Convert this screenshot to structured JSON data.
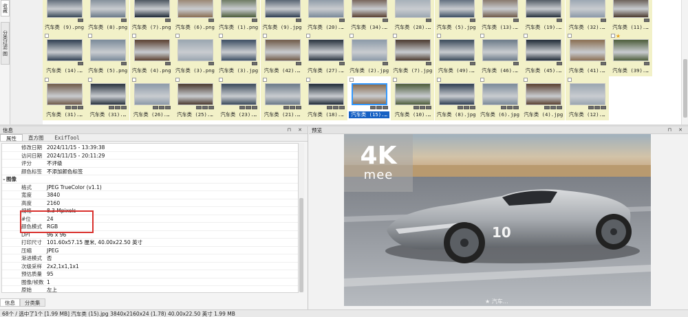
{
  "side_tabs": [
    "收藏",
    "分类过滤 图"
  ],
  "thumbnails": {
    "rows": [
      [
        "汽车类 (9).png",
        "汽车类 (8).png",
        "汽车类 (7).png",
        "汽车类 (6).png",
        "汽车类 (1).png",
        "汽车类 (9).jpg",
        "汽车类 (20).…",
        "汽车类 (34).…",
        "汽车类 (28).…",
        "汽车类 (5).jpg",
        "汽车类 (13).…",
        "汽车类 (19).…",
        "汽车类 (32).…",
        "汽车类 (11).…"
      ],
      [
        "汽车类 (14).…",
        "汽车类 (5).png",
        "汽车类 (4).png",
        "汽车类 (3).png",
        "汽车类 (3).jpg",
        "汽车类 (42).…",
        "汽车类 (27).…",
        "汽车类 (2).jpg",
        "汽车类 (7).jpg",
        "汽车类 (49).…",
        "汽车类 (46).…",
        "汽车类 (45).…",
        "汽车类 (41).…",
        "汽车类 (39).…"
      ],
      [
        "汽车类 (31).…",
        "汽车类 (31).…",
        "汽车类 (26).…",
        "汽车类 (25).…",
        "汽车类 (23).…",
        "汽车类 (21).…",
        "汽车类 (18).…",
        "汽车类 (15).…",
        "汽车类 (10).…",
        "汽车类 (8).jpg",
        "汽车类 (6).jpg",
        "汽车类 (4).jpg",
        "汽车类 (12).…"
      ]
    ],
    "selected": {
      "row": 2,
      "col": 7
    }
  },
  "info_panel": {
    "title": "信息",
    "buttons": "⊓ ✕",
    "tabs": [
      "属性",
      "直方图",
      "ExifTool"
    ],
    "rows": [
      {
        "k": "修改日期",
        "v": "2024/11/15 - 13:39:38"
      },
      {
        "k": "访问日期",
        "v": "2024/11/15 - 20:11:29"
      },
      {
        "k": "评分",
        "v": "不评级"
      },
      {
        "k": "颜色标签",
        "v": "不添加颜色标签"
      },
      {
        "k": "图像",
        "v": "",
        "section": true
      },
      {
        "k": "格式",
        "v": "JPEG TrueColor (v1.1)"
      },
      {
        "k": "宽度",
        "v": "3840"
      },
      {
        "k": "高度",
        "v": "2160"
      },
      {
        "k": "规格",
        "v": "8.3 Mpixels"
      },
      {
        "k": "#位",
        "v": "24"
      },
      {
        "k": "颜色模式",
        "v": "RGB"
      },
      {
        "k": "DPI",
        "v": "96 x 96"
      },
      {
        "k": "打印尺寸",
        "v": "101.60x57.15 厘米, 40.00x22.50 英寸"
      },
      {
        "k": "压缩",
        "v": "JPEG"
      },
      {
        "k": "渐进模式",
        "v": "否"
      },
      {
        "k": "次级采样",
        "v": "2x2,1x1,1x1"
      },
      {
        "k": "预估质量",
        "v": "95"
      },
      {
        "k": "图像/帧数",
        "v": "1"
      },
      {
        "k": "原始",
        "v": "左上"
      }
    ],
    "section_toggle": "⌄",
    "bottom_tabs": [
      "信息",
      "分类集"
    ]
  },
  "preview_panel": {
    "title": "预览",
    "buttons": "⊓ ✕",
    "watermark_big": "4K",
    "watermark_small": "mee",
    "car_number": "10",
    "corner_mark": "★ 汽车…"
  },
  "status_bar": "68个 / 选中了1个 [1.99 MB]  汽车类 (15).jpg  3840x2160x24 (1.78)  40.00x22.50 英寸  1.99 MB",
  "colors": {
    "caption_bg": "#f2f1c8",
    "selection": "#1560c4",
    "highlight_box": "#d9302c"
  }
}
